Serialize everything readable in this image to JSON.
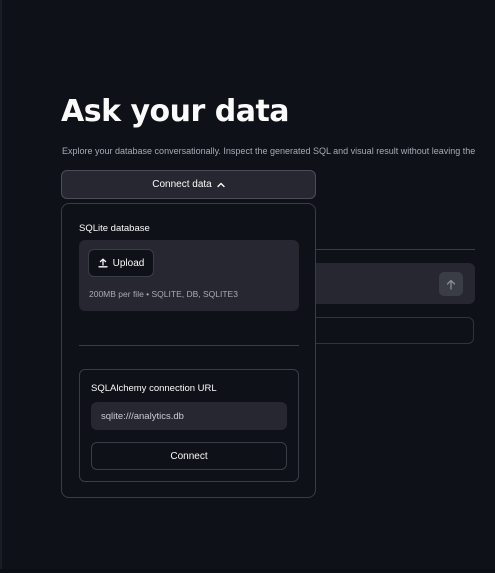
{
  "header": {
    "title": "Ask your data",
    "subtitle": "Explore your database conversationally. Inspect the generated SQL and visual result without leaving the"
  },
  "connect_toggle": {
    "label": "Connect data",
    "icon": "chevron-up-icon",
    "expanded": true
  },
  "sqlite": {
    "label": "SQLite database",
    "upload_button": "Upload",
    "upload_icon": "upload-icon",
    "help_text": "200MB per file • SQLITE, DB, SQLITE3"
  },
  "sqlalchemy": {
    "label": "SQLAlchemy connection URL",
    "url_value": "sqlite:///analytics.db",
    "connect_button": "Connect"
  },
  "chat": {
    "send_icon": "arrow-up-icon"
  },
  "colors": {
    "background": "#0e1117",
    "surface": "#262730",
    "border": "#3a3d47",
    "text": "#fafafa",
    "muted_text": "#a7abb4"
  }
}
